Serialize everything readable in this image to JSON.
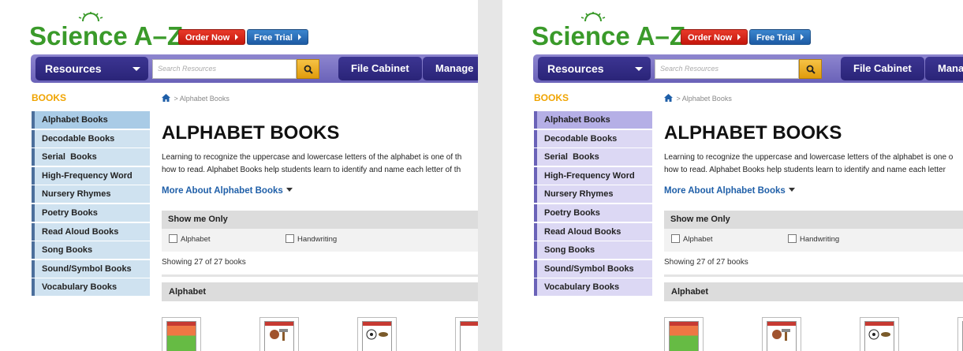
{
  "brand": {
    "name": "Science A–Z"
  },
  "header": {
    "order_now": "Order Now",
    "free_trial": "Free Trial"
  },
  "nav": {
    "resources": "Resources",
    "search_placeholder": "Search Resources",
    "file_cabinet": "File Cabinet",
    "manage": "Manage"
  },
  "sidebar": {
    "heading": "BOOKS",
    "items": [
      {
        "label": "Alphabet Books"
      },
      {
        "label": "Decodable Books"
      },
      {
        "label": "Serial  Books"
      },
      {
        "label": "High-Frequency Word"
      },
      {
        "label": "Nursery Rhymes"
      },
      {
        "label": "Poetry Books"
      },
      {
        "label": "Read Aloud Books"
      },
      {
        "label": "Song Books"
      },
      {
        "label": "Sound/Symbol Books"
      },
      {
        "label": "Vocabulary Books"
      }
    ]
  },
  "breadcrumb": {
    "current": "> Alphabet Books"
  },
  "main": {
    "title": "ALPHABET BOOKS",
    "desc_left": [
      "Learning to recognize the uppercase and lowercase letters of the alphabet is one of th",
      "how to read. Alphabet Books help students learn to identify and name each letter of th"
    ],
    "desc_right": [
      "Learning to recognize the uppercase and lowercase letters of the alphabet is one o",
      "how to read. Alphabet Books help students learn to identify and name each letter"
    ],
    "more_about": "More About Alphabet Books",
    "filter_heading": "Show me Only",
    "filter_options": [
      "Alphabet",
      "Handwriting"
    ],
    "showing": "Showing 27 of 27 books",
    "section": "Alphabet"
  },
  "colors": {
    "left_sidebar_bg": "#cfe2f0",
    "left_sidebar_active": "#a9cbe6",
    "left_sidebar_border": "#4c6f9c",
    "right_sidebar_bg": "#dcd8f4",
    "right_sidebar_active": "#b5afe6",
    "right_sidebar_border": "#6a62b8"
  }
}
